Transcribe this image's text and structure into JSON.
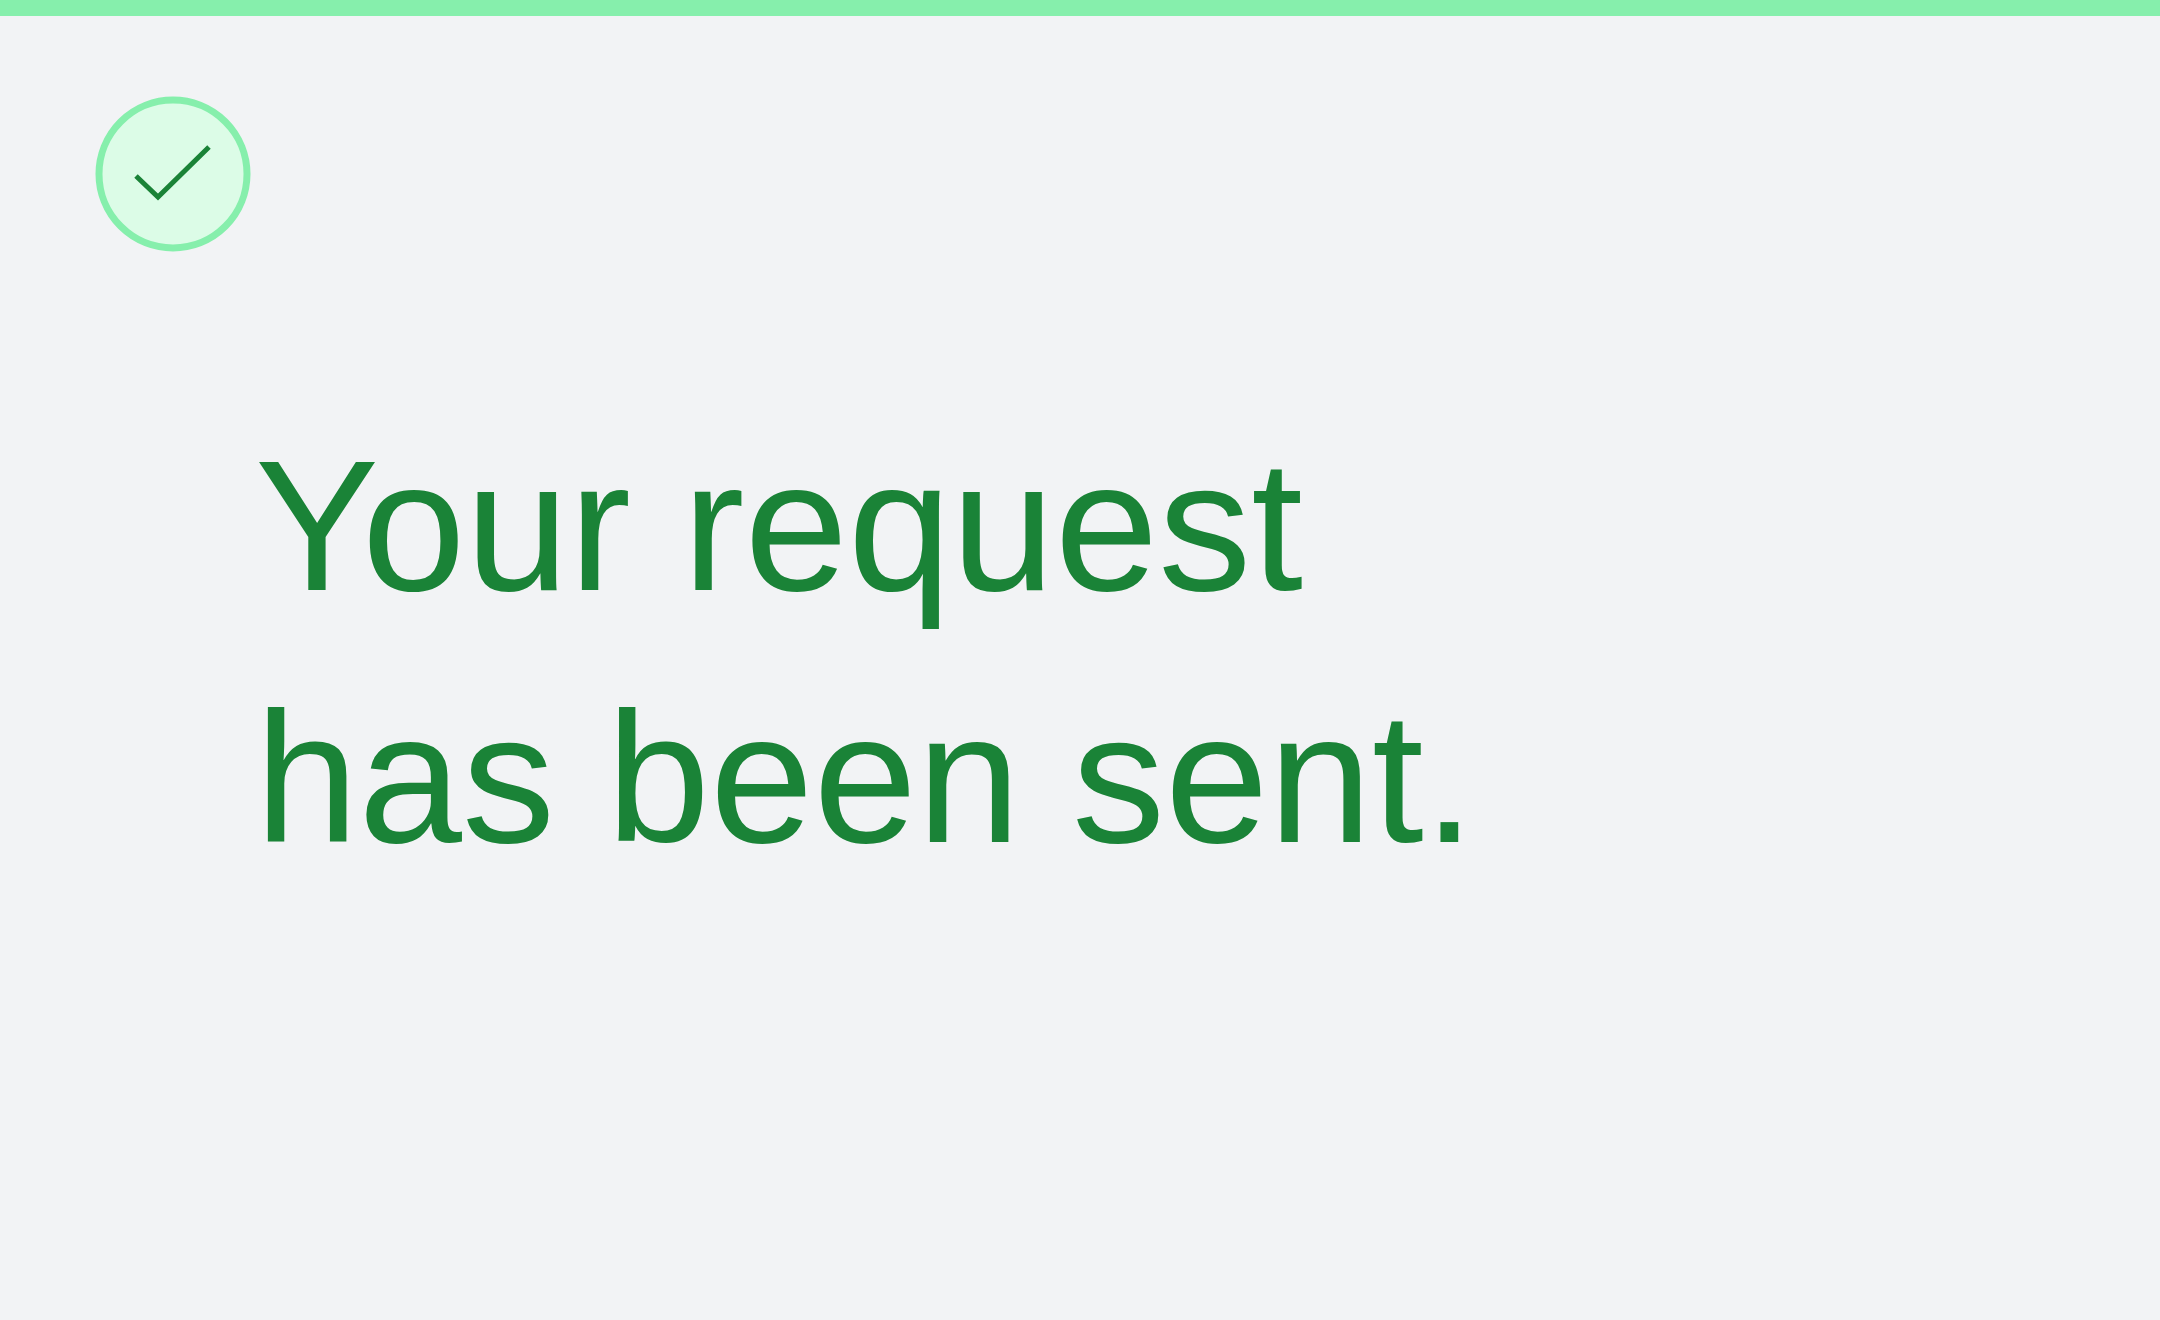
{
  "status": {
    "kind": "success"
  },
  "message": "Your request has been sent."
}
